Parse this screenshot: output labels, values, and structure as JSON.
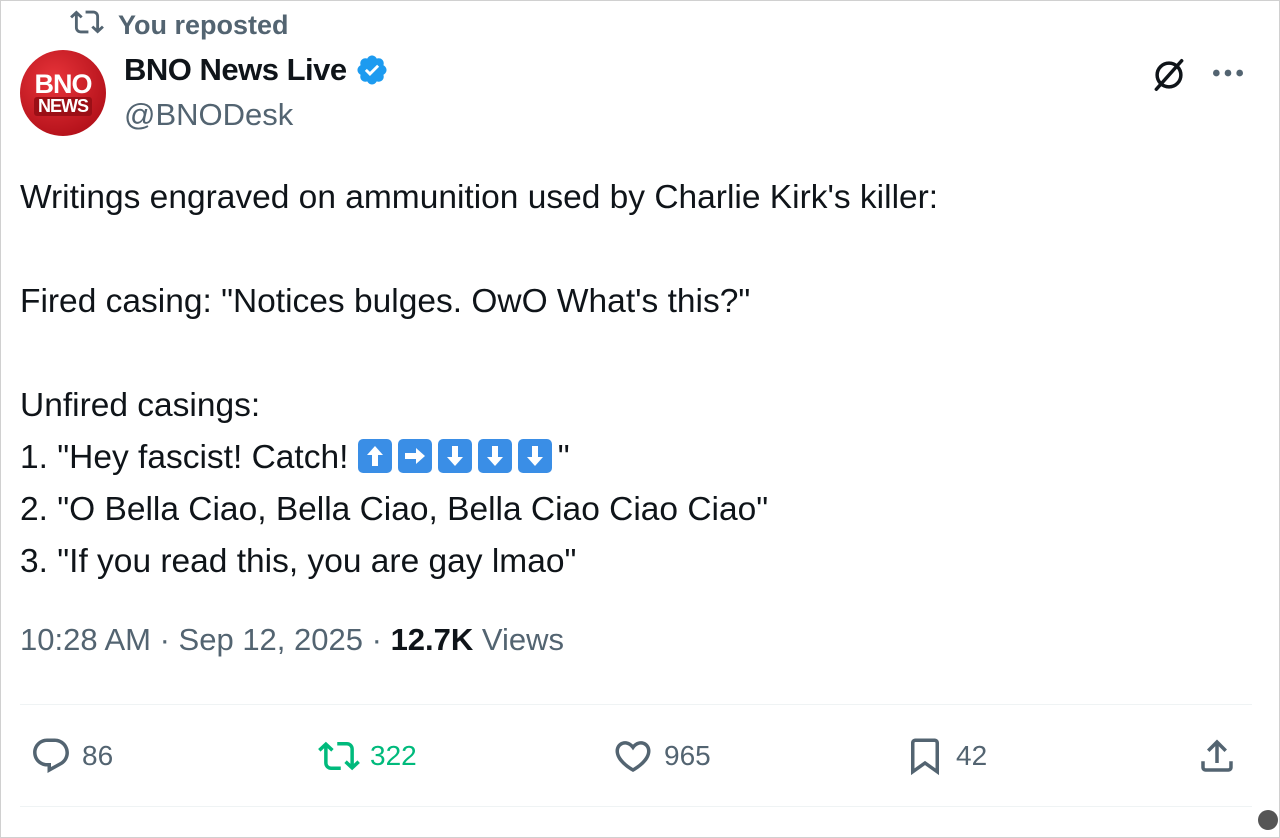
{
  "repost_label": "You reposted",
  "author": {
    "name": "BNO News Live",
    "handle": "@BNODesk",
    "avatar_line1": "BNO",
    "avatar_line2": "NEWS",
    "verified_color": "#1d9bf0"
  },
  "post": {
    "line1": "Writings engraved on ammunition used by Charlie Kirk's killer:",
    "line2": "Fired casing: \"Notices bulges. OwO What's this?\"",
    "line3": "Unfired casings:",
    "item1_prefix": "1. \"Hey fascist! Catch! ",
    "item1_arrows": [
      "up",
      "right",
      "down",
      "down",
      "down"
    ],
    "item1_suffix": "\"",
    "item2": "2. \"O Bella Ciao, Bella Ciao, Bella Ciao Ciao Ciao\"",
    "item3": "3. \"If you read this, you are gay lmao\""
  },
  "meta": {
    "time": "10:28 AM",
    "date": "Sep 12, 2025",
    "sep": " · ",
    "views_count": "12.7K",
    "views_label": "Views"
  },
  "actions": {
    "replies": "86",
    "reposts": "322",
    "likes": "965",
    "bookmarks": "42"
  },
  "colors": {
    "accent": "#1d9bf0",
    "repost_active": "#00ba7c",
    "secondary_text": "#536471",
    "arrow_emoji_bg": "#3a8ee6"
  }
}
